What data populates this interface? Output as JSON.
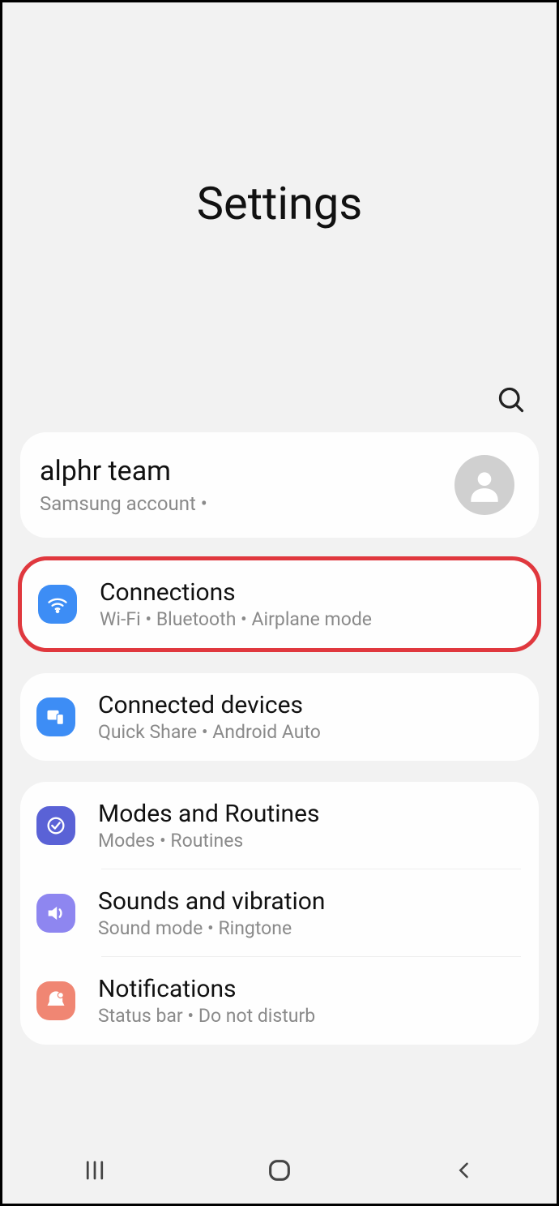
{
  "title": "Settings",
  "account": {
    "name": "alphr team",
    "sub": "Samsung account  •"
  },
  "groups": [
    {
      "highlighted": true,
      "rows": [
        {
          "icon": "wifi",
          "iconColor": "#3d8df5",
          "title": "Connections",
          "sub": "Wi-Fi  •  Bluetooth  •  Airplane mode"
        }
      ]
    },
    {
      "rows": [
        {
          "icon": "devices",
          "iconColor": "#3d8df5",
          "title": "Connected devices",
          "sub": "Quick Share  •  Android Auto"
        }
      ]
    },
    {
      "rows": [
        {
          "icon": "routines",
          "iconColor": "#5a62d6",
          "title": "Modes and Routines",
          "sub": "Modes  •  Routines",
          "divider": true
        },
        {
          "icon": "sound",
          "iconColor": "#8e86f0",
          "title": "Sounds and vibration",
          "sub": "Sound mode  •  Ringtone",
          "divider": true
        },
        {
          "icon": "notifications",
          "iconColor": "#f08673",
          "title": "Notifications",
          "sub": "Status bar  •  Do not disturb"
        }
      ]
    }
  ]
}
